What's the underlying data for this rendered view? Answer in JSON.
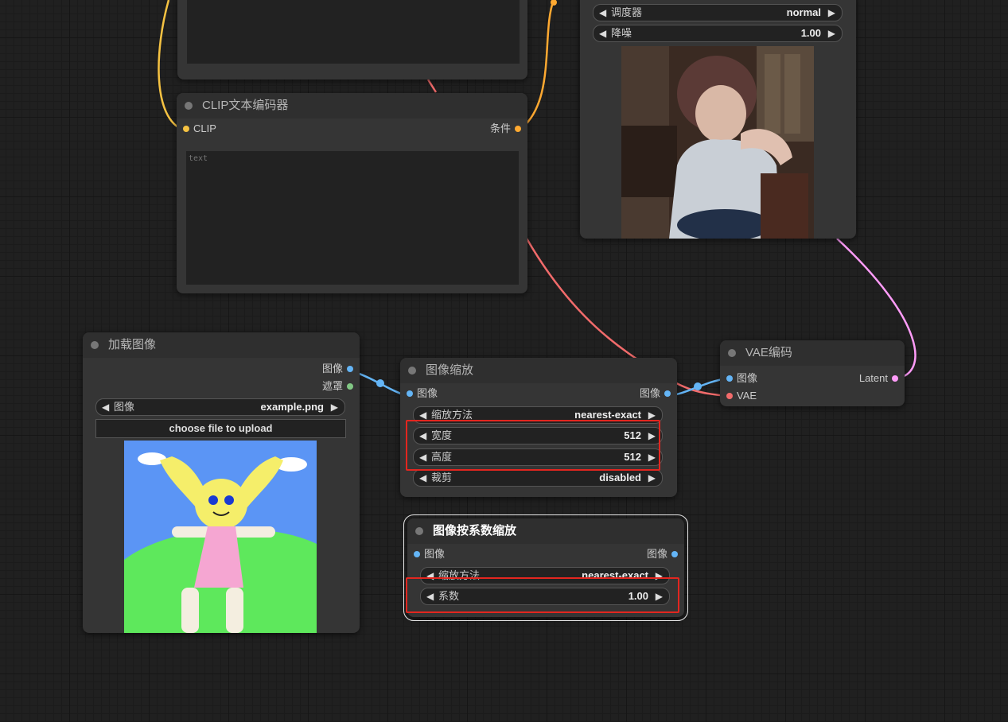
{
  "top_left_node": {},
  "clip_node": {
    "title": "CLIP文本编码器",
    "input_clip": "CLIP",
    "output_condition": "条件",
    "text_placeholder": "text"
  },
  "sampler_node": {
    "scheduler_label": "调度器",
    "scheduler_value": "normal",
    "denoise_label": "降噪",
    "denoise_value": "1.00"
  },
  "load_image_node": {
    "title": "加载图像",
    "output_image": "图像",
    "output_mask": "遮罩",
    "image_label": "图像",
    "image_value": "example.png",
    "upload_label": "choose file to upload"
  },
  "image_scale_node": {
    "title": "图像缩放",
    "input_image": "图像",
    "output_image": "图像",
    "method_label": "缩放方法",
    "method_value": "nearest-exact",
    "width_label": "宽度",
    "width_value": "512",
    "height_label": "高度",
    "height_value": "512",
    "crop_label": "裁剪",
    "crop_value": "disabled"
  },
  "scale_by_node": {
    "title": "图像按系数缩放",
    "input_image": "图像",
    "output_image": "图像",
    "method_label": "缩放方法",
    "method_value": "nearest-exact",
    "factor_label": "系数",
    "factor_value": "1.00"
  },
  "vae_node": {
    "title": "VAE编码",
    "input_image": "图像",
    "input_vae": "VAE",
    "output_latent": "Latent"
  },
  "colors": {
    "clip_wire": "#f5c242",
    "vae_wire": "#f26b6b",
    "image_wire": "#64b5f6",
    "latent_wire": "#ff9cf9",
    "mask_port": "#81c784",
    "condition_port": "#ffa931",
    "highlight": "#e3261f"
  }
}
